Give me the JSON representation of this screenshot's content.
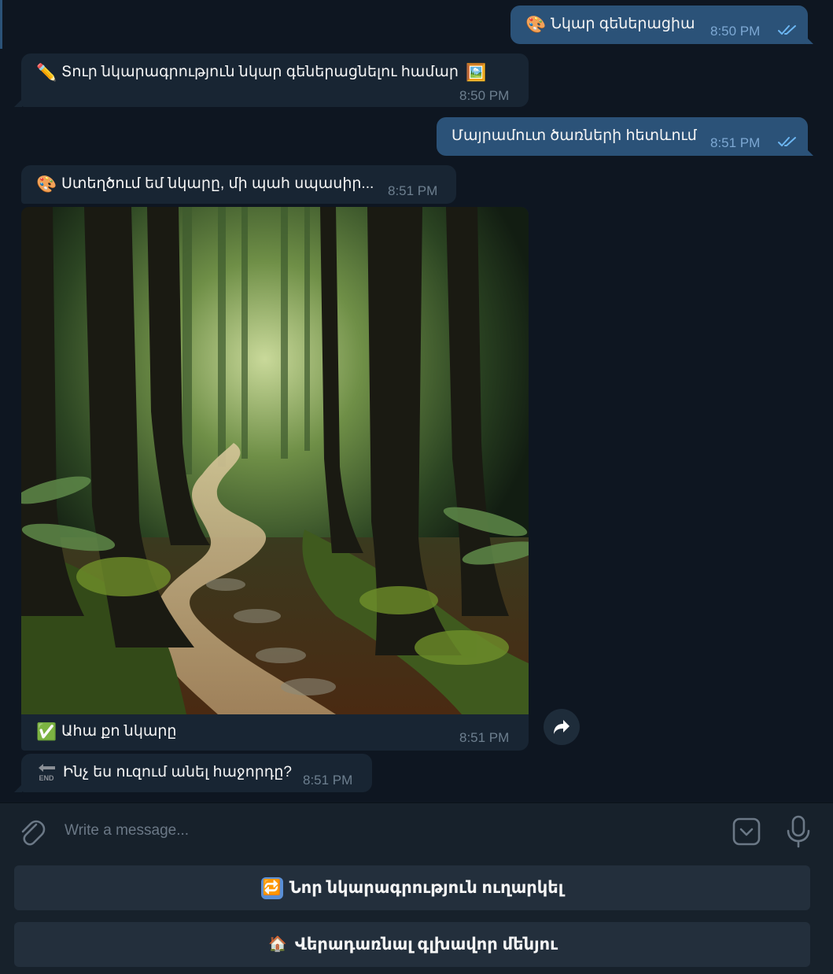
{
  "messages": [
    {
      "direction": "outgoing",
      "emoji": "🎨",
      "text": "Նկար գեներացիա",
      "time": "8:50 PM",
      "status": "read"
    },
    {
      "direction": "incoming",
      "emoji": "✏️",
      "text": "Տուր նկարագրություն նկար գեներացնելու համար",
      "emoji_after": "🖼️",
      "time": "8:50 PM"
    },
    {
      "direction": "outgoing",
      "text": "Մայրամուտ ծառների հետևում",
      "time": "8:51 PM",
      "status": "read"
    },
    {
      "direction": "incoming",
      "emoji": "🎨",
      "text": "Ստեղծում եմ նկարը, մի պահ սպասիր...",
      "time": "8:51 PM"
    },
    {
      "direction": "incoming",
      "type": "photo",
      "emoji": "✅",
      "caption": "Ահա քո նկարը",
      "time": "8:51 PM"
    },
    {
      "direction": "incoming",
      "emoji": "🔚",
      "text": "Ինչ ես ուզում անել հաջորդը?",
      "time": "8:51 PM"
    }
  ],
  "composer": {
    "placeholder": "Write a message..."
  },
  "keyboard": [
    {
      "emoji": "🔁",
      "label": "Նոր նկարագրություն ուղարկել"
    },
    {
      "emoji": "🏠",
      "label": "Վերադառնալ գլխավոր մենյու"
    }
  ],
  "colors": {
    "background": "#0e1621",
    "outgoing_bubble": "#2b5278",
    "incoming_bubble": "#182533",
    "composer": "#17212b",
    "keyboard_button": "#232f3c",
    "read_ticks": "#6cb6f2"
  }
}
